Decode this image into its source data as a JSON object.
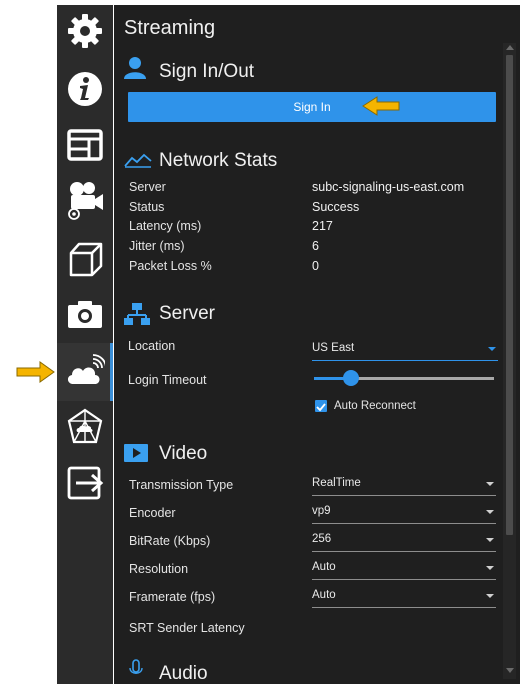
{
  "header": {
    "title": "Streaming"
  },
  "rail": {
    "icons": [
      "gear-icon",
      "info-icon",
      "layout-icon",
      "camera-settings-icon",
      "cube-icon",
      "camera-icon",
      "cloud-streaming-icon",
      "network-shield-icon",
      "exit-icon"
    ],
    "selected": "cloud-streaming-icon"
  },
  "signin": {
    "title": "Sign In/Out",
    "button_label": "Sign In"
  },
  "network_stats": {
    "title": "Network Stats",
    "rows": [
      {
        "label": "Server",
        "value": "subc-signaling-us-east.com"
      },
      {
        "label": "Status",
        "value": "Success"
      },
      {
        "label": "Latency (ms)",
        "value": "217"
      },
      {
        "label": "Jitter (ms)",
        "value": "6"
      },
      {
        "label": "Packet Loss %",
        "value": "0"
      }
    ]
  },
  "server": {
    "title": "Server",
    "location_label": "Location",
    "location_value": "US East",
    "timeout_label": "Login Timeout",
    "timeout_level": 0.2,
    "auto_reconnect_label": "Auto Reconnect",
    "auto_reconnect_checked": true
  },
  "video": {
    "title": "Video",
    "rows": [
      {
        "label": "Transmission Type",
        "value": "RealTime"
      },
      {
        "label": "Encoder",
        "value": "vp9"
      },
      {
        "label": "BitRate (Kbps)",
        "value": "256"
      },
      {
        "label": "Resolution",
        "value": "Auto"
      },
      {
        "label": "Framerate (fps)",
        "value": "Auto"
      }
    ],
    "srt_label": "SRT Sender Latency"
  },
  "audio": {
    "title": "Audio"
  },
  "colors": {
    "rail_bg": "#2b2b2b",
    "panel_bg": "#1f1f1f",
    "accent_blue": "#2f93ea",
    "callout_arrow": "#f5b400"
  }
}
